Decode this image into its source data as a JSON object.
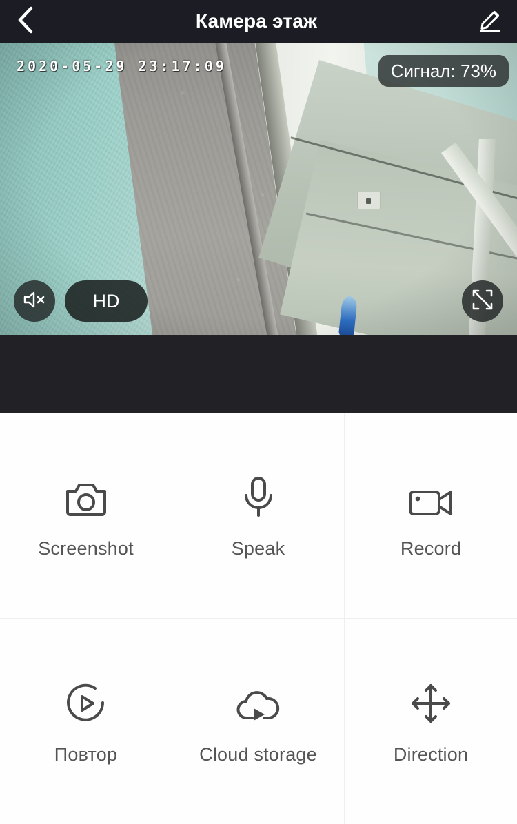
{
  "header": {
    "title": "Камера этаж",
    "back_icon": "chevron-left-icon",
    "edit_icon": "pencil-edit-icon"
  },
  "video": {
    "timestamp": "2020-05-29 23:17:09",
    "signal_label": "Сигнал: 73%",
    "signal_percent": 73,
    "quality_label": "HD",
    "mute_icon": "speaker-muted-icon",
    "fullscreen_icon": "fullscreen-expand-icon",
    "scene_description": "fisheye hallway view"
  },
  "colors": {
    "header_bg": "#1c1d24",
    "band_bg": "#212126",
    "label_text": "#555555",
    "icon_stroke": "#4a4a4a",
    "divider": "#efefef"
  },
  "actions": [
    {
      "label": "Screenshot",
      "icon": "camera-icon"
    },
    {
      "label": "Speak",
      "icon": "microphone-icon"
    },
    {
      "label": "Record",
      "icon": "video-camera-icon"
    },
    {
      "label": "Повтор",
      "icon": "replay-play-circle-icon"
    },
    {
      "label": "Cloud storage",
      "icon": "cloud-play-icon"
    },
    {
      "label": "Direction",
      "icon": "four-way-arrows-icon"
    }
  ]
}
